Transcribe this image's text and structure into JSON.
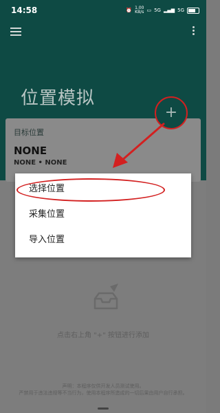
{
  "status_bar": {
    "time": "14:58",
    "network_speed": "1.00 KB/s",
    "network_speed_value": "1.00",
    "network_speed_unit": "KB/s",
    "signal_1": "5G",
    "signal_2": "5G",
    "icons": [
      "alarm-icon",
      "vowifi-icon",
      "signal-icon",
      "battery-icon"
    ]
  },
  "toolbar": {
    "menu_icon": "menu-icon",
    "more_icon": "more-vertical-icon"
  },
  "page": {
    "title": "位置模拟"
  },
  "fab": {
    "label": "+",
    "icon": "plus-icon"
  },
  "location_card": {
    "label": "目标位置",
    "name": "NONE",
    "subtitle": "NONE • NONE"
  },
  "popup_menu": {
    "items": [
      {
        "label": "选择位置"
      },
      {
        "label": "采集位置"
      },
      {
        "label": "导入位置"
      }
    ]
  },
  "empty_state": {
    "icon": "inbox-paper-plane-icon",
    "text": "点击右上角 \"+\" 按钮进行添加"
  },
  "footer": {
    "line1": "声明：本程序仅供开发人员测试使用。",
    "line2": "严禁用于违法违规等不当行为，使用本程序所造成的一切后果由用户自行承担。"
  },
  "colors": {
    "header": "#0e4a44",
    "overlay_body": "#7d7d7d",
    "annotation": "#d32020",
    "menu_bg": "#ffffff"
  }
}
